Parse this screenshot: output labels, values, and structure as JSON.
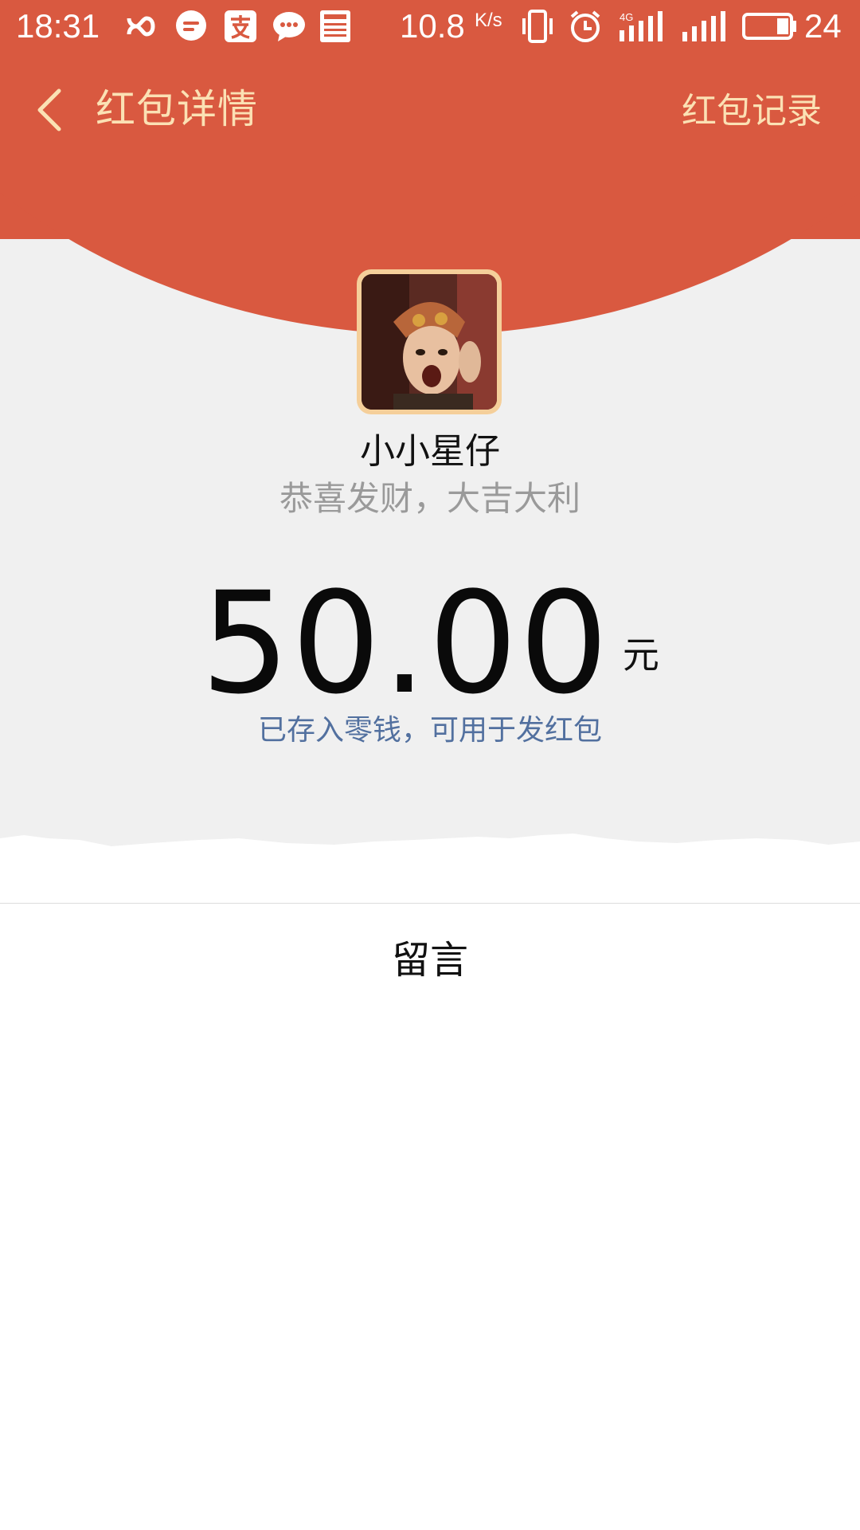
{
  "status_bar": {
    "time": "18:31",
    "net_speed": "10.8",
    "net_speed_unit": "K/s",
    "battery_level": "24",
    "icons": [
      "infinity-icon",
      "chat-bubble-icon",
      "alipay-icon",
      "wechat-icon",
      "news-icon",
      "vibrate-icon",
      "alarm-icon",
      "signal-4g-icon",
      "signal-icon",
      "battery-icon"
    ]
  },
  "nav": {
    "title": "红包详情",
    "right_link": "红包记录"
  },
  "sender": {
    "name": "小小星仔",
    "greeting": "恭喜发财，大吉大利"
  },
  "amount": {
    "value": "50.00",
    "unit": "元",
    "note": "已存入零钱，可用于发红包"
  },
  "message_section": {
    "label": "留言"
  },
  "colors": {
    "header_red": "#D95940",
    "header_text": "#FBE1B4",
    "note_blue": "#52709F",
    "avatar_border": "#F5CF9A"
  }
}
